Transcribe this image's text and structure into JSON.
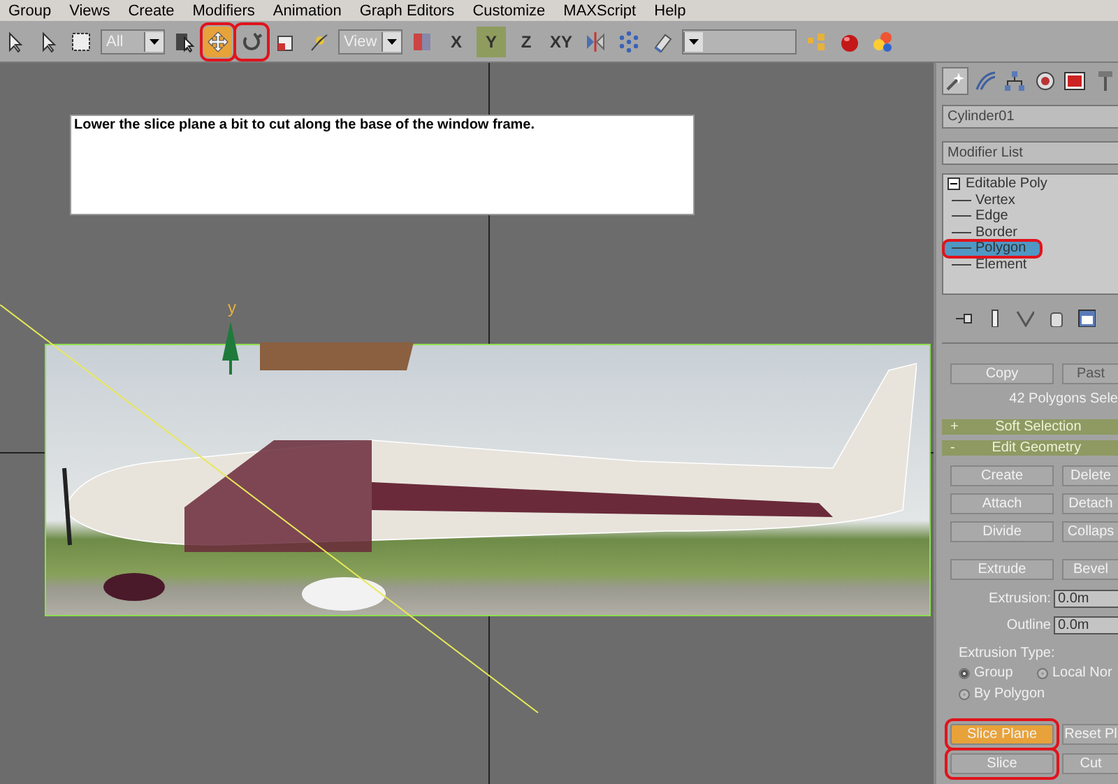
{
  "menu": [
    "Group",
    "Views",
    "Create",
    "Modifiers",
    "Animation",
    "Graph Editors",
    "Customize",
    "MAXScript",
    "Help"
  ],
  "toolbar": [
    {
      "kind": "tool",
      "selected": false,
      "circled": false
    },
    {
      "kind": "tool",
      "selected": false,
      "circled": false
    },
    {
      "kind": "tool",
      "selected": false,
      "circled": false
    },
    {
      "kind": "dropdown",
      "value": "All"
    },
    {
      "kind": "tool",
      "selected": false,
      "circled": false
    },
    {
      "kind": "tool",
      "selected": true,
      "circled": true
    },
    {
      "kind": "tool",
      "selected": false,
      "circled": true
    },
    {
      "kind": "tool",
      "selected": false,
      "circled": false
    },
    {
      "kind": "tool",
      "selected": false,
      "circled": false
    },
    {
      "kind": "dropdown",
      "value": "View"
    },
    {
      "kind": "tool",
      "selected": false,
      "circled": false
    },
    {
      "kind": "axis",
      "label": "X",
      "selected": false
    },
    {
      "kind": "axis",
      "label": "Y",
      "selected": true
    },
    {
      "kind": "axis",
      "label": "Z",
      "selected": false
    },
    {
      "kind": "axis",
      "label": "XY",
      "selected": false
    },
    {
      "kind": "tool",
      "selected": false,
      "circled": false
    },
    {
      "kind": "tool",
      "selected": false,
      "circled": false
    },
    {
      "kind": "tool",
      "selected": false,
      "circled": false
    },
    {
      "kind": "dropdown"
    },
    {
      "kind": "tool",
      "selected": false,
      "circled": false
    },
    {
      "kind": "tool",
      "selected": false,
      "circled": false
    },
    {
      "kind": "tool",
      "selected": false,
      "circled": false
    }
  ],
  "viewport": {
    "note": "Lower the slice plane a bit to cut along the base of the window frame.",
    "gizmo_axis": "y"
  },
  "panel": {
    "tabs": [
      {
        "selected": true
      },
      {
        "selected": false
      },
      {
        "selected": false
      },
      {
        "selected": false
      },
      {
        "selected": false
      },
      {
        "selected": false
      }
    ],
    "object_name": "Cylinder01",
    "modifier_list": "Modifier List",
    "stack": [
      {
        "label": "Editable Poly",
        "expanded": true,
        "children": [
          {
            "label": "Vertex",
            "selected": false,
            "circled": false
          },
          {
            "label": "Edge",
            "selected": false,
            "circled": false
          },
          {
            "label": "Border",
            "selected": false,
            "circled": false
          },
          {
            "label": "Polygon",
            "selected": true,
            "circled": true
          },
          {
            "label": "Element",
            "selected": false,
            "circled": false
          }
        ]
      }
    ],
    "copy_paste": [
      {
        "label": "Copy",
        "disabled": false
      },
      {
        "label": "Past",
        "disabled": true
      }
    ],
    "selection_info": "42 Polygons Sele",
    "rollouts": [
      {
        "sign": "+",
        "title": "Soft Selection"
      },
      {
        "sign": "-",
        "title": "Edit Geometry"
      }
    ],
    "geometry_buttons": [
      [
        "Create",
        "Delete"
      ],
      [
        "Attach",
        "Detach"
      ],
      [
        "Divide",
        "Collaps"
      ]
    ],
    "extrude_buttons": [
      "Extrude",
      "Bevel"
    ],
    "fields": [
      {
        "label": "Extrusion:",
        "value": "0.0m"
      },
      {
        "label": "Outline",
        "value": "0.0m"
      }
    ],
    "extrusion_type": {
      "label": "Extrusion Type:",
      "options": [
        {
          "label": "Group",
          "selected": true
        },
        {
          "label": "Local Nor",
          "selected": false
        },
        {
          "label": "By Polygon",
          "selected": false
        }
      ]
    },
    "slice_buttons": [
      {
        "label": "Slice Plane",
        "selected": true,
        "circled": true
      },
      {
        "label": "Reset Pl",
        "selected": false,
        "circled": false
      },
      {
        "label": "Slice",
        "selected": false,
        "circled": true
      },
      {
        "label": "Cut",
        "selected": false,
        "circled": false
      }
    ]
  }
}
